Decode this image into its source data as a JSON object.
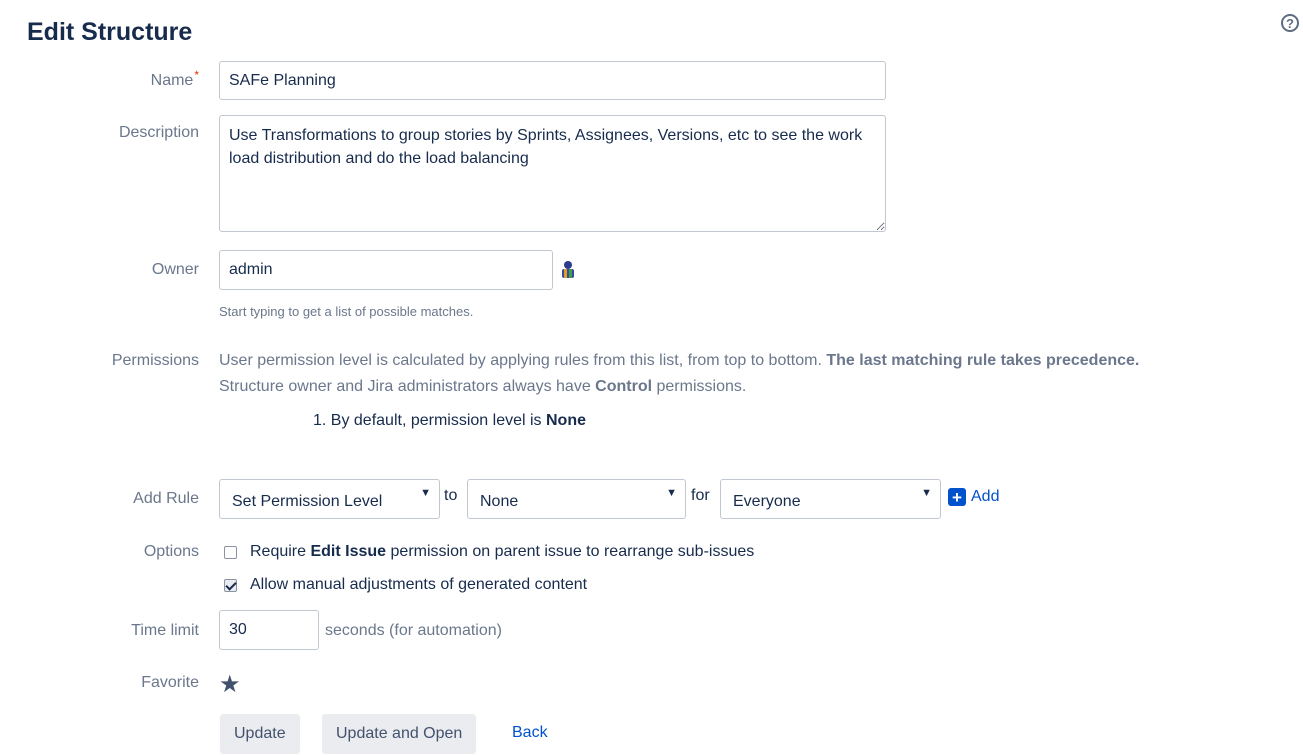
{
  "page": {
    "title": "Edit Structure"
  },
  "form": {
    "name": {
      "label": "Name",
      "required_mark": "*",
      "value": "SAFe Planning"
    },
    "description": {
      "label": "Description",
      "value": "Use Transformations to group stories by Sprints, Assignees, Versions, etc to see the work load distribution and do the load balancing"
    },
    "owner": {
      "label": "Owner",
      "value": "admin",
      "hint": "Start typing to get a list of possible matches."
    },
    "permissions": {
      "label": "Permissions",
      "text_1": "User permission level is calculated by applying rules from this list, from top to bottom.",
      "text_1_bold": "The last matching rule takes precedence.",
      "text_2_pre": "Structure owner and Jira administrators always have",
      "text_2_bold": "Control",
      "text_2_post": "permissions.",
      "rule_1_pre": "1. By default, permission level is",
      "rule_1_bold": "None"
    },
    "add_rule": {
      "label": "Add Rule",
      "action_value": "Set Permission Level",
      "to_text": "to",
      "level_value": "None",
      "for_text": "for",
      "target_value": "Everyone",
      "add_label": "Add"
    },
    "options": {
      "label": "Options",
      "option_1_pre": "Require",
      "option_1_bold": "Edit Issue",
      "option_1_post": "permission on parent issue to rearrange sub-issues",
      "option_1_checked": false,
      "option_2": "Allow manual adjustments of generated content",
      "option_2_checked": true
    },
    "time_limit": {
      "label": "Time limit",
      "value": "30",
      "unit": "seconds (for automation)"
    },
    "favorite": {
      "label": "Favorite"
    }
  },
  "buttons": {
    "update": "Update",
    "update_open": "Update and Open",
    "back": "Back"
  },
  "icons": {
    "help": "help-icon",
    "owner_picker": "user-picker-icon",
    "add": "plus-icon",
    "favorite": "star-icon",
    "dropdown": "chevron-down-icon"
  },
  "colors": {
    "accent": "#0052cc",
    "label": "#6b778c",
    "text": "#172b4d",
    "required": "#de350b",
    "button_bg": "#ebecf0"
  }
}
